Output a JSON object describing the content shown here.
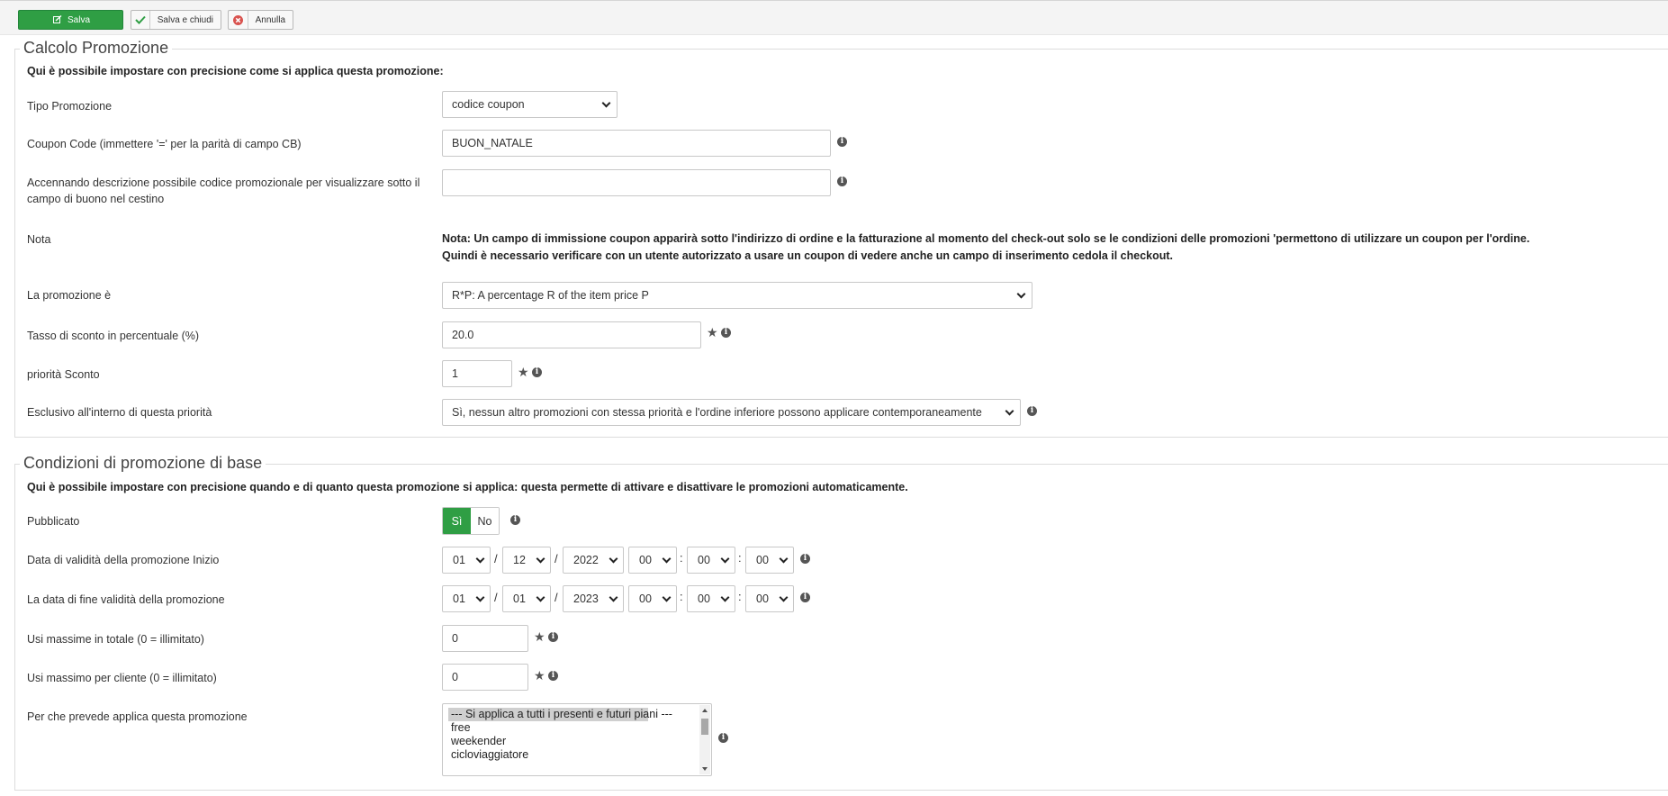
{
  "toolbar": {
    "save": "Salva",
    "save_close": "Salva e chiudi",
    "cancel": "Annulla"
  },
  "calc": {
    "legend": "Calcolo Promozione",
    "intro": "Qui è possibile impostare con precisione come si applica questa promozione:",
    "tipo_label": "Tipo Promozione",
    "tipo_value": "codice coupon",
    "coupon_label": "Coupon Code (immettere '=' per la parità di campo CB)",
    "coupon_value": "BUON_NATALE",
    "descr_label": "Accennando descrizione possibile codice promozionale per visualizzare sotto il campo di buono nel cestino",
    "descr_value": "",
    "nota_label": "Nota",
    "nota_line1": "Nota: Un campo di immissione coupon apparirà sotto l'indirizzo di ordine e la fatturazione al momento del check-out solo se le condizioni delle promozioni 'permettono di utilizzare un coupon per l'ordine.",
    "nota_line2": "Quindi è necessario verificare con un utente autorizzato a usare un coupon di vedere anche un campo di inserimento cedola il checkout.",
    "promo_label": "La promozione è",
    "promo_value": "R*P: A percentage R of the item price P",
    "tasso_label": "Tasso di sconto in percentuale (%)",
    "tasso_value": "20.0",
    "priorita_label": "priorità Sconto",
    "priorita_value": "1",
    "esclusivo_label": "Esclusivo all'interno di questa priorità",
    "esclusivo_value": "Sì, nessun altro promozioni con stessa priorità e l'ordine inferiore possono applicare contemporaneamente"
  },
  "cond": {
    "legend": "Condizioni di promozione di base",
    "intro": "Qui è possibile impostare con precisione quando e di quanto questa promozione si applica: questa permette di attivare e disattivare le promozioni automaticamente.",
    "pub_label": "Pubblicato",
    "pub_yes": "Sì",
    "pub_no": "No",
    "pub_value": "Sì",
    "start_label": "Data di validità della promozione Inizio",
    "start": {
      "day": "01",
      "month": "12",
      "year": "2022",
      "hour": "00",
      "min": "00",
      "sec": "00"
    },
    "end_label": "La data di fine validità della promozione",
    "end": {
      "day": "01",
      "month": "01",
      "year": "2023",
      "hour": "00",
      "min": "00",
      "sec": "00"
    },
    "date_sep": "/",
    "time_sep": ":",
    "max_total_label": "Usi massime in totale (0 = illimitato)",
    "max_total_value": "0",
    "max_client_label": "Usi massimo per cliente (0 = illimitato)",
    "max_client_value": "0",
    "plans_label": "Per che prevede applica questa promozione",
    "plans": [
      "--- Si applica a tutti i presenti e futuri piani ---",
      "free",
      "weekender",
      "cicloviaggiatore"
    ]
  },
  "colors": {
    "accent_green": "#2f9e44",
    "cancel_red": "#d9534f"
  },
  "icons": {
    "info": "info-circle-icon",
    "star": "star-icon"
  }
}
